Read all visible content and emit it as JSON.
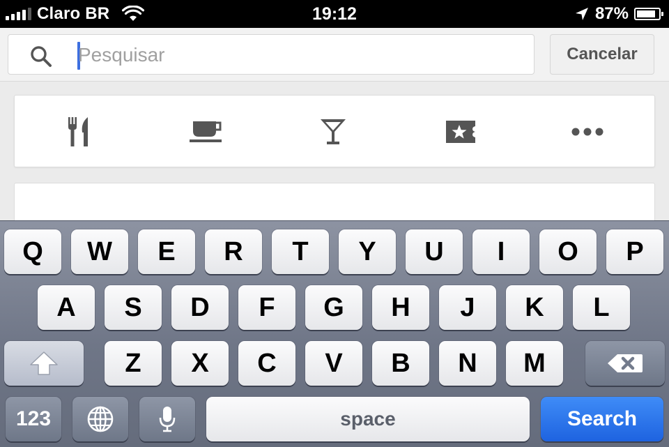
{
  "status_bar": {
    "carrier": "Claro BR",
    "time": "19:12",
    "battery": "87%",
    "battery_level": 0.87,
    "signal_bars": 4
  },
  "search": {
    "placeholder": "Pesquisar",
    "value": "",
    "cancel_label": "Cancelar"
  },
  "categories": [
    {
      "icon": "fork-knife-icon",
      "label": "restaurants"
    },
    {
      "icon": "coffee-cup-icon",
      "label": "coffee"
    },
    {
      "icon": "cocktail-icon",
      "label": "nightlife"
    },
    {
      "icon": "ticket-icon",
      "label": "entertainment"
    },
    {
      "icon": "more-icon",
      "label": "more"
    }
  ],
  "keyboard": {
    "row1": [
      "Q",
      "W",
      "E",
      "R",
      "T",
      "Y",
      "U",
      "I",
      "O",
      "P"
    ],
    "row2": [
      "A",
      "S",
      "D",
      "F",
      "G",
      "H",
      "J",
      "K",
      "L"
    ],
    "row3": [
      "Z",
      "X",
      "C",
      "V",
      "B",
      "N",
      "M"
    ],
    "numbers_label": "123",
    "space_label": "space",
    "search_label": "Search"
  },
  "colors": {
    "accent": "#1e63e0",
    "caret": "#3d6fe0",
    "icon": "#555555"
  }
}
